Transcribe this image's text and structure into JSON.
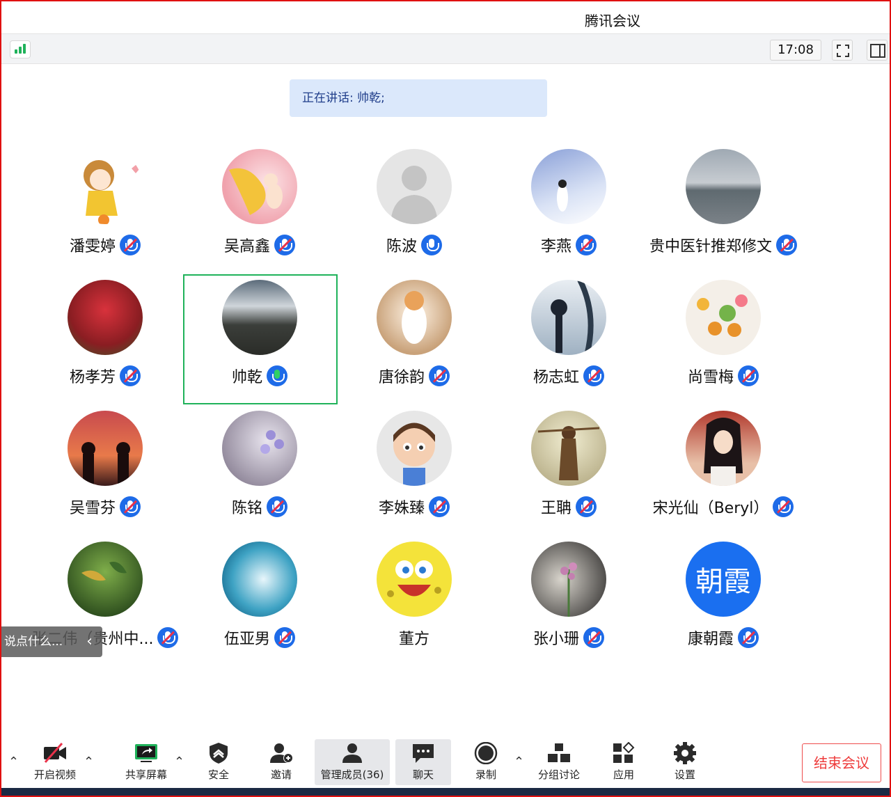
{
  "window": {
    "title": "腾讯会议"
  },
  "top_toolbar": {
    "time": "17:08"
  },
  "speaking_banner": "正在讲话: 帅乾;",
  "participants": [
    {
      "name": "潘雯婷",
      "mic": "muted"
    },
    {
      "name": "吴高鑫",
      "mic": "muted"
    },
    {
      "name": "陈波",
      "mic": "active"
    },
    {
      "name": "李燕",
      "mic": "muted"
    },
    {
      "name": "贵中医针推郑修文",
      "mic": "muted"
    },
    {
      "name": "杨孝芳",
      "mic": "muted"
    },
    {
      "name": "帅乾",
      "mic": "speaking"
    },
    {
      "name": "唐徐韵",
      "mic": "muted"
    },
    {
      "name": "杨志虹",
      "mic": "muted"
    },
    {
      "name": "尚雪梅",
      "mic": "muted"
    },
    {
      "name": "吴雪芬",
      "mic": "muted"
    },
    {
      "name": "陈铭",
      "mic": "muted"
    },
    {
      "name": "李姝臻",
      "mic": "muted"
    },
    {
      "name": "王聃",
      "mic": "muted"
    },
    {
      "name": "宋光仙（Beryl）",
      "mic": "muted"
    },
    {
      "name": "张二伟（贵州中...",
      "mic": "muted"
    },
    {
      "name": "伍亚男",
      "mic": "muted"
    },
    {
      "name": "董方",
      "mic": "none"
    },
    {
      "name": "张小珊",
      "mic": "muted"
    },
    {
      "name": "康朝霞",
      "mic": "muted",
      "avatar_text": "朝霞"
    }
  ],
  "chat_hint": "说点什么...",
  "bottom_toolbar": {
    "video": "开启视频",
    "share": "共享屏幕",
    "security": "安全",
    "invite": "邀请",
    "members": "管理成员(36)",
    "chat": "聊天",
    "record": "录制",
    "breakout": "分组讨论",
    "apps": "应用",
    "settings": "设置",
    "end": "结束会议"
  },
  "colors": {
    "accent": "#1e6be8",
    "speaking_border": "#1fb25a",
    "end_red": "#ee3b3b"
  }
}
